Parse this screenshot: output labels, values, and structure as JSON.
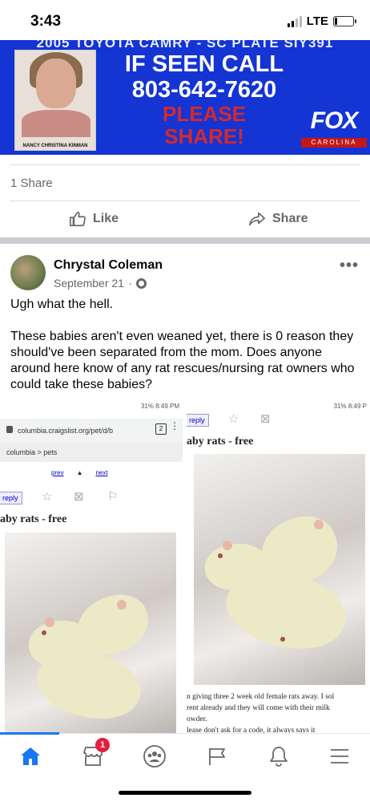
{
  "status_bar": {
    "time": "3:43",
    "network": "LTE",
    "signal_bars_active": 2,
    "signal_bars_total": 4,
    "battery_level": 0.12
  },
  "banner": {
    "top_text": "2005 TOYOTA CAMRY - SC PLATE SIY391",
    "person_name": "NANCY CHRISTINA KINMAN",
    "line1": "IF SEEN CALL",
    "line2": "803-642-7620",
    "line3": "PLEASE",
    "line4": "SHARE!",
    "logo_word": "FOX",
    "logo_sub": "CAROLINA",
    "colors": {
      "background": "#1434d4",
      "alert": "#d32a2a"
    }
  },
  "first_post": {
    "share_count": "1 Share",
    "like_label": "Like",
    "share_label": "Share"
  },
  "post": {
    "author": "Chrystal Coleman",
    "date": "September 21",
    "date_separator": "·",
    "more_icon": "more-horizontal-icon",
    "text_line1": "Ugh what the hell.",
    "text_para2": "These babies aren't even weaned yet, there is 0 reason they should've been separated from the mom. Does anyone around here know of any rat rescues/nursing rat owners who could take these babies?"
  },
  "screenshot_left": {
    "status": "31% 8:49 PM",
    "url": "columbia.craigslist.org/pet/d/b",
    "tab_count": "2",
    "breadcrumb": "columbia > pets",
    "prev": "prev",
    "next": "next",
    "reply": "reply",
    "title": "aby rats - free"
  },
  "screenshot_right": {
    "status": "31% 8:49 P",
    "reply": "reply",
    "title": "aby rats - free",
    "desc_line1": "n giving three 2 week old female rats away. I sol",
    "desc_line2": "rent already and they will come with their milk",
    "desc_line3": "owder.",
    "desc_line4": "lease don't ask for a code, it always says it"
  },
  "bottom_nav": {
    "items": [
      "home-icon",
      "marketplace-icon",
      "groups-icon",
      "pages-icon",
      "notifications-icon",
      "menu-icon"
    ],
    "marketplace_badge": "1",
    "active_color": "#1877f2"
  }
}
